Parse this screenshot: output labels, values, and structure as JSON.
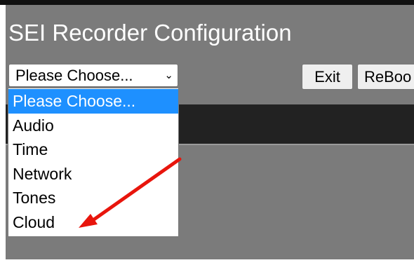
{
  "page": {
    "title": "SEI Recorder Configuration"
  },
  "toolbar": {
    "select_value": "Please Choose...",
    "exit_label": "Exit",
    "reboot_label": "ReBoo"
  },
  "dropdown": {
    "options": [
      "Please Choose...",
      "Audio",
      "Time",
      "Network",
      "Tones",
      "Cloud"
    ],
    "selected_index": 0
  },
  "colors": {
    "background": "#7b7b7b",
    "nav_band": "#222222",
    "highlight": "#1e90ff",
    "annotation_arrow": "#e8150c"
  },
  "icons": {
    "select_chevron": "chevron-down-icon",
    "annotation": "red-arrow-icon"
  }
}
